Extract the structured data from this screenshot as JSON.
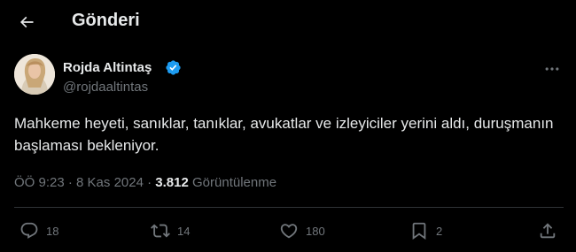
{
  "header": {
    "title": "Gönderi",
    "back_icon": "arrow-left-icon"
  },
  "author": {
    "display_name": "Rojda Altintaş",
    "handle": "@rojdaaltintas",
    "verified_color": "#1d9bf0"
  },
  "tweet": {
    "text": "Mahkeme heyeti, sanıklar, tanıklar, avukatlar ve izleyiciler yerini aldı, duruşmanın başlaması bekleniyor."
  },
  "meta": {
    "time": "ÖÖ 9:23",
    "separator": "·",
    "date": "8 Kas 2024",
    "views_count": "3.812",
    "views_label": "Görüntülenme"
  },
  "actions": {
    "replies": "18",
    "reposts": "14",
    "likes": "180",
    "bookmarks": "2"
  },
  "colors": {
    "background": "#000000",
    "text_primary": "#e7e9ea",
    "text_secondary": "#71767b",
    "divider": "#2f3336"
  }
}
